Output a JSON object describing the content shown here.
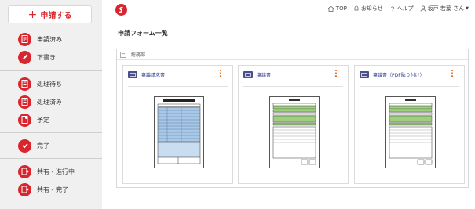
{
  "sidebar": {
    "new_button": "申請する",
    "items": [
      {
        "label": "申請済み",
        "icon": "doc-check-icon"
      },
      {
        "label": "下書き",
        "icon": "pencil-icon"
      },
      {
        "label": "処理待ち",
        "icon": "doc-wait-icon"
      },
      {
        "label": "処理済み",
        "icon": "doc-done-icon"
      },
      {
        "label": "予定",
        "icon": "doc-schedule-icon"
      },
      {
        "label": "完了",
        "icon": "check-icon"
      },
      {
        "label": "共有 - 進行中",
        "icon": "share-progress-icon"
      },
      {
        "label": "共有 - 完了",
        "icon": "share-done-icon"
      }
    ]
  },
  "header": {
    "top": "TOP",
    "news": "お知らせ",
    "help": "ヘルプ",
    "user": "坂戸 若葉 さん"
  },
  "main": {
    "title": "申請フォーム一覧",
    "group": {
      "name": "総務部",
      "forms": [
        {
          "title": "稟議請求書"
        },
        {
          "title": "稟議書"
        },
        {
          "title": "稟議書（PDF貼り付け）"
        }
      ]
    }
  },
  "colors": {
    "accent": "#d9262e",
    "link": "#2b3a8f",
    "menu": "#e8731f",
    "sidebar_bg": "#f0f0f0",
    "form_highlight_blue": "#a9c8e8",
    "form_highlight_green": "#9ed07c"
  }
}
